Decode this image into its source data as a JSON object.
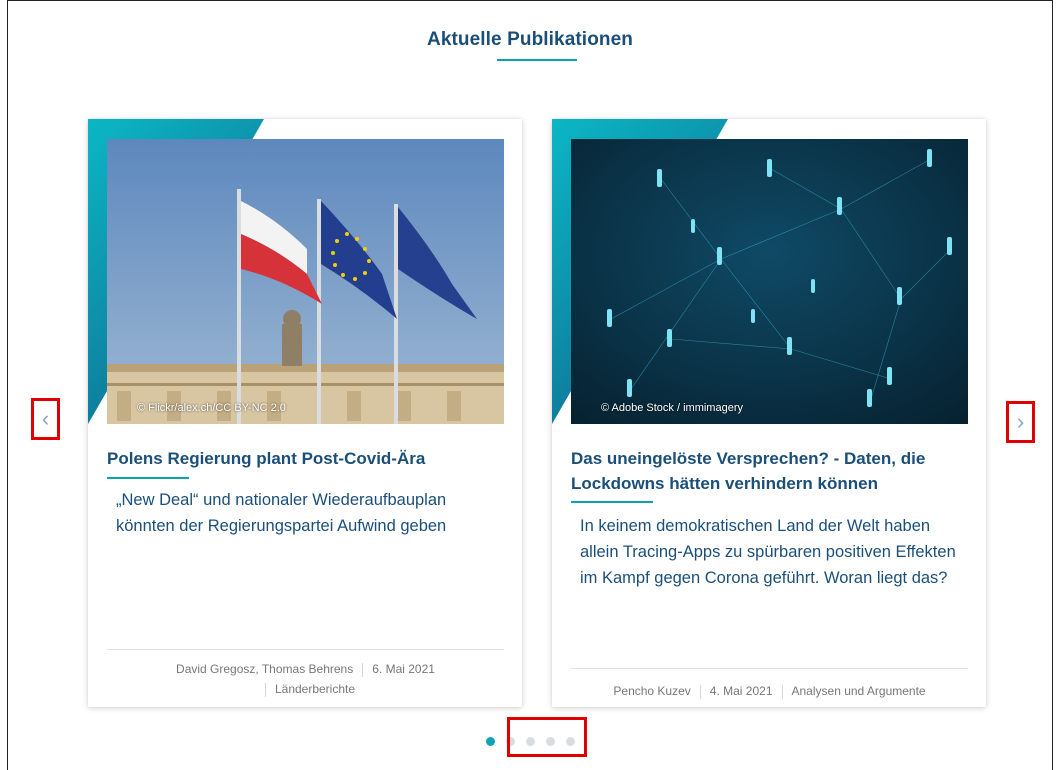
{
  "section": {
    "title": "Aktuelle Publikationen"
  },
  "cards": [
    {
      "credit": "© Flickr/alex.ch/CC BY-NC 2.0",
      "title": "Polens Regierung plant Post-Covid-Ära",
      "description": "„New Deal“ und nationaler Wiederaufbauplan könnten der Regierungspartei Aufwind geben",
      "authors": "David Gregosz, Thomas Behrens",
      "date": "6. Mai 2021",
      "category": "Länderberichte"
    },
    {
      "credit": "© Adobe Stock / immimagery",
      "title": "Das uneingelöste Versprechen? - Daten, die Lockdowns hätten verhindern können",
      "description": "In keinem demokratischen Land der Welt haben allein Tracing-Apps zu spürbaren positiven Effekten im Kampf gegen Corona geführt. Woran liegt das?",
      "authors": "Pencho Kuzev",
      "date": "4. Mai 2021",
      "category": "Analysen und Argumente"
    }
  ],
  "carousel": {
    "prev_icon": "chevron-left-icon",
    "next_icon": "chevron-right-icon",
    "prev_glyph": "‹",
    "next_glyph": "›",
    "active_page": 1,
    "page_count": 5
  },
  "colors": {
    "accent": "#0ea2b2",
    "heading": "#1b4f7a",
    "highlight": "#e00000"
  }
}
